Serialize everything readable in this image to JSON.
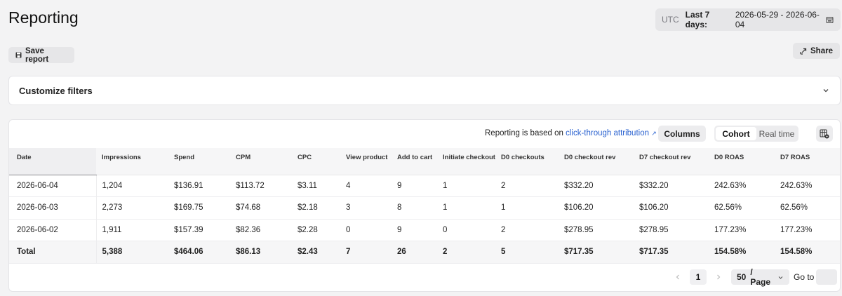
{
  "page": {
    "title": "Reporting"
  },
  "date_range": {
    "timezone": "UTC",
    "label": "Last 7 days:",
    "value": "2026-05-29 - 2026-06-04",
    "icon": "calendar-icon"
  },
  "toolbar": {
    "save_label": "Save report",
    "save_icon": "save-icon",
    "share_label": "Share",
    "share_icon": "share-icon"
  },
  "filters": {
    "title": "Customize filters",
    "icon": "chevron-down-icon"
  },
  "table_toolbar": {
    "attribution_prefix": "Reporting is based on",
    "attribution_link": "click-through attribution",
    "attribution_icon": "external-link-icon",
    "columns_label": "Columns",
    "modes": [
      "Cohort",
      "Real time"
    ],
    "active_mode": "Cohort",
    "export_icon": "export-settings-icon"
  },
  "table": {
    "headers": [
      "Date",
      "Impressions",
      "Spend",
      "CPM",
      "CPC",
      "View product",
      "Add to cart",
      "Initiate checkout",
      "D0 checkouts",
      "D0 checkout rev",
      "D7 checkout rev",
      "D0 ROAS",
      "D7 ROAS"
    ],
    "rows": [
      [
        "2026-06-04",
        "1,204",
        "$136.91",
        "$113.72",
        "$3.11",
        "4",
        "9",
        "1",
        "2",
        "$332.20",
        "$332.20",
        "242.63%",
        "242.63%"
      ],
      [
        "2026-06-03",
        "2,273",
        "$169.75",
        "$74.68",
        "$2.18",
        "3",
        "8",
        "1",
        "1",
        "$106.20",
        "$106.20",
        "62.56%",
        "62.56%"
      ],
      [
        "2026-06-02",
        "1,911",
        "$157.39",
        "$82.36",
        "$2.28",
        "0",
        "9",
        "0",
        "2",
        "$278.95",
        "$278.95",
        "177.23%",
        "177.23%"
      ]
    ],
    "total": [
      "Total",
      "5,388",
      "$464.06",
      "$86.13",
      "$2.43",
      "7",
      "26",
      "2",
      "5",
      "$717.35",
      "$717.35",
      "154.58%",
      "154.58%"
    ]
  },
  "pagination": {
    "current_page": "1",
    "page_size": "50",
    "page_size_suffix": "/ Page",
    "goto_label": "Go to",
    "goto_value": ""
  }
}
